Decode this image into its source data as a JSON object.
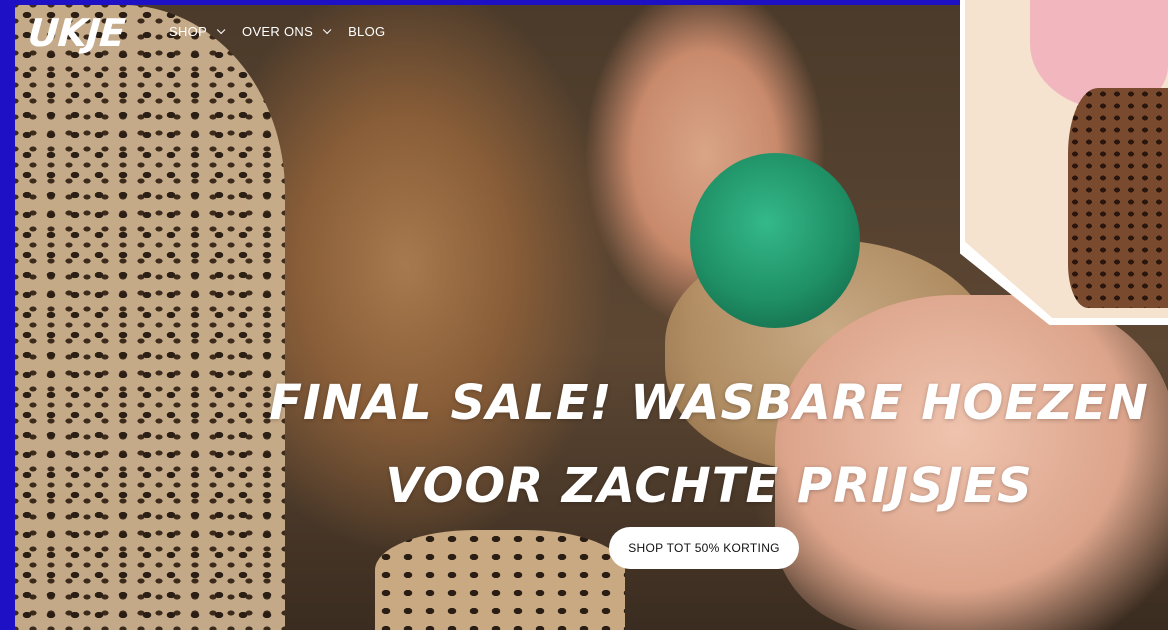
{
  "brand": {
    "logo_text": "UKJE"
  },
  "nav": {
    "items": [
      {
        "label": "SHOP",
        "has_dropdown": true,
        "icon": "chevron-down-icon"
      },
      {
        "label": "OVER ONS",
        "has_dropdown": true,
        "icon": "chevron-down-icon"
      },
      {
        "label": "BLOG",
        "has_dropdown": false
      }
    ]
  },
  "hero": {
    "headline": "FINAL SALE! WASBARE HOEZEN VOOR ZACHTE PRIJSJES",
    "cta_label": "SHOP TOT 50% KORTING"
  },
  "colors": {
    "frame": "#1e10c4",
    "text": "#ffffff",
    "button_bg": "#ffffff",
    "button_text": "#111111",
    "pacifier": "#1f8f65",
    "inset_pink": "#f2b7be"
  }
}
